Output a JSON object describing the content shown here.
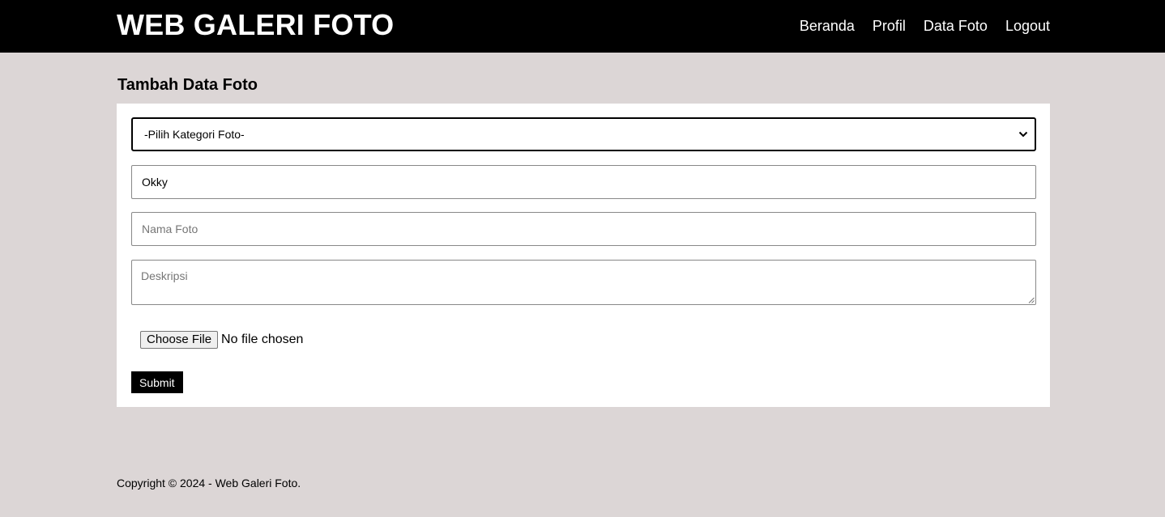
{
  "header": {
    "logo": "WEB GALERI FOTO",
    "nav": [
      "Beranda",
      "Profil",
      "Data Foto",
      "Logout"
    ]
  },
  "page": {
    "title": "Tambah Data Foto"
  },
  "form": {
    "category_select": {
      "selected": "-Pilih Kategori Foto-"
    },
    "name_input": {
      "value": "Okky"
    },
    "photo_name_input": {
      "value": "",
      "placeholder": "Nama Foto"
    },
    "description_input": {
      "value": "",
      "placeholder": "Deskripsi"
    },
    "file_input": {
      "button_label": "Choose File",
      "status": "No file chosen"
    },
    "submit_label": "Submit"
  },
  "footer": {
    "copyright": "Copyright © 2024 - Web Galeri Foto."
  },
  "colors": {
    "header_bg": "#000000",
    "page_bg": "#dcd6d6",
    "card_bg": "#ffffff",
    "submit_bg": "#000000"
  },
  "icons": {
    "select_arrow": "chevron-down-icon",
    "textarea_resize": "resize-grip-icon"
  }
}
